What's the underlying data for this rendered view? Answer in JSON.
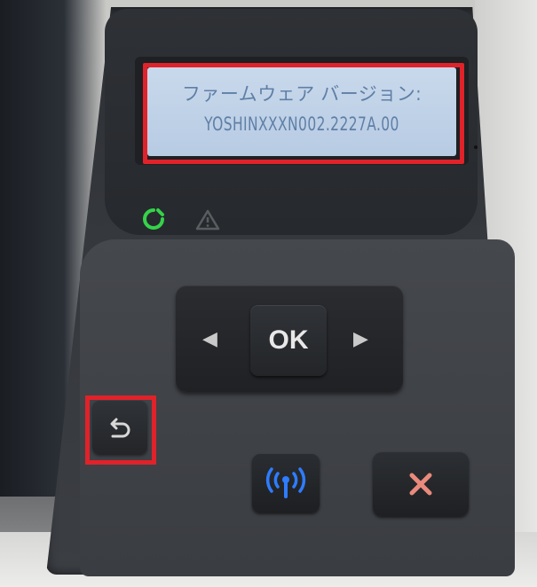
{
  "display": {
    "line1": "ファームウェア バージョン:",
    "line2": "YOSHINXXXN002.2227A.00"
  },
  "buttons": {
    "ok_label": "OK",
    "left_arrow": "◀",
    "right_arrow": "▶"
  },
  "icons": {
    "ready": "ready-light-icon",
    "attention": "warning-triangle-icon",
    "back": "back-arrow-icon",
    "wireless": "wireless-antenna-icon",
    "cancel": "cancel-x-icon"
  },
  "colors": {
    "highlight": "#e0222a",
    "ready_light": "#35d24a",
    "wireless_light": "#2f7cff",
    "cancel_x": "#e98a7c",
    "lcd_background": "#c2d4ea",
    "lcd_text": "#5f7fa6"
  }
}
